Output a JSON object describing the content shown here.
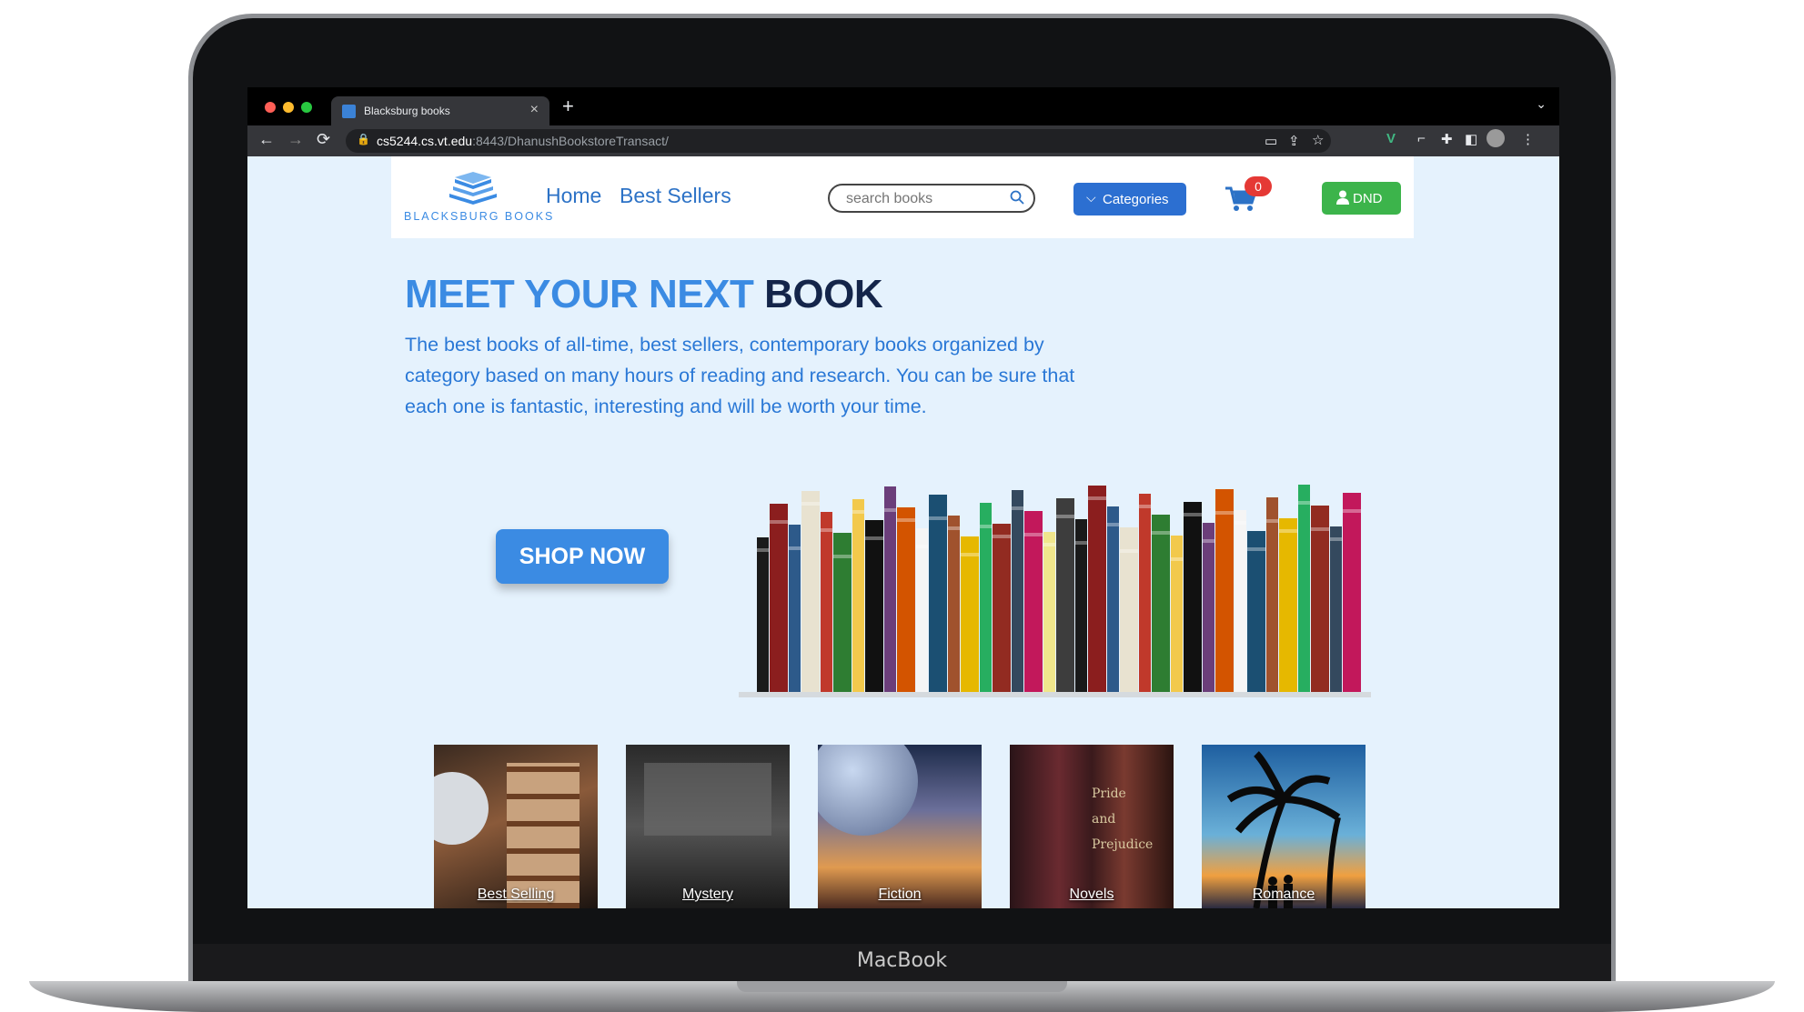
{
  "device": {
    "label": "MacBook"
  },
  "browser": {
    "tab_title": "Blacksburg books",
    "url_host": "cs5244.cs.vt.edu",
    "url_path": ":8443/DhanushBookstoreTransact/"
  },
  "header": {
    "logo_text": "BLACKSBURG BOOKS",
    "nav": [
      "Home",
      "Best Sellers"
    ],
    "search_placeholder": "search books",
    "categories_label": "Categories",
    "cart_count": "0",
    "user_label": "DND"
  },
  "hero": {
    "title_accent": "MEET YOUR NEXT",
    "title_dark": "BOOK",
    "text": "The best books of all-time, best sellers, contemporary books organized by category based on many hours of reading and research. You can be sure that each one is fantastic, interesting and will be worth your time.",
    "cta": "SHOP NOW"
  },
  "categories": [
    "Best Selling",
    "Mystery",
    "Fiction",
    "Novels",
    "Romance"
  ],
  "colors": {
    "accent": "#3b8be3",
    "dark": "#14254a",
    "page_bg": "#e5f2fd",
    "category_button": "#2c6fd1",
    "user_button": "#3cb44b",
    "badge": "#e53935"
  }
}
